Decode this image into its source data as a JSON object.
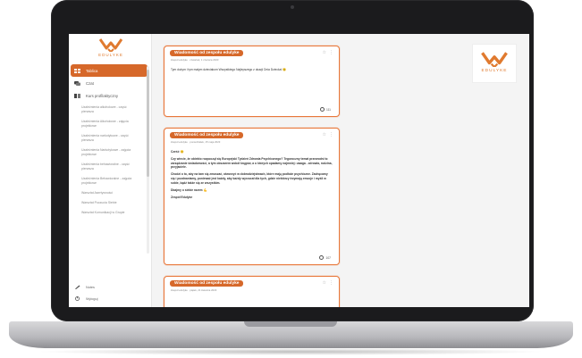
{
  "app": {
    "logo_text": "EDULYKE",
    "accent_color": "#d6682a"
  },
  "sidebar": {
    "nav": [
      {
        "label": "Tablica",
        "icon": "grid-icon",
        "active": true
      },
      {
        "label": "Czat",
        "icon": "chat-icon",
        "active": false
      },
      {
        "label": "Kurs profilaktyczny",
        "icon": "book-icon",
        "active": false
      }
    ],
    "sub_items": [
      "Uzależnienia alkoholowe - część pierwsza",
      "Uzależnienia Alkoholowe - zajęcia projektowe",
      "Uzależnienia narkotykowe - część pierwsza",
      "Uzależnienia Narkotykowe - zajęcia projektowe",
      "Uzależnienia behawioralne - część pierwsza",
      "Uzależnienia Behawioralne - zajęcia projektowe",
      "Warsztat Asertywności",
      "Warsztat Poczucia Siebie",
      "Warsztat Komunikacji w Grupie"
    ],
    "bottom": [
      {
        "label": "Notes",
        "icon": "pencil-icon"
      },
      {
        "label": "Wyloguj",
        "icon": "logout-icon"
      }
    ]
  },
  "posts": [
    {
      "title": "Wiadomość od zespołu edulyke",
      "meta": "Zespół edulyke · czwartek, 1 czerwca 2023",
      "paragraphs": [
        "Tym dużym i tym małym dzieciakom Wszystkiego Najlepszego z okazji Dnia Dziecka! 😉"
      ],
      "views": "111"
    },
    {
      "title": "Wiadomość od zespołu edulyke",
      "meta": "Zespół edulyke · poniedziałek, 15 maja 2023",
      "paragraphs": [
        "Cześć 😊",
        "Czy wiecie, że obiekto rozpoczął się Europejski Tydzień Zdrowia Psychicznego? Tegoroczny temat przewodni to zarządzanie świadomości, a tym obszarem wokół kręgów, a o których opadamy najmniej: uwaga - zdrowia, rodzina, przyjaciele.",
        "Chodzi o to, aby na tam się zmuszać, otworzyć w dobrodziejstwach, które mają podłoże psychiczne. Zachęcamy się i pozdrawiamy, ponieważ jest każdy, aby każdy wyrzucał dla tych, gdzie niektórzy trzymają emocje i myśli w sobie, bądź także się ze wszystkim.",
        "Dbajmy o siebie razem 💪",
        "Zespół Edulyke"
      ],
      "views": "107"
    },
    {
      "title": "Wiadomość od zespołu edulyke",
      "meta": "Zespół edulyke · piątek, 21 kwietnia 2023",
      "paragraphs": [],
      "views": ""
    }
  ],
  "brand_box": {
    "text": "EDULYKE"
  }
}
